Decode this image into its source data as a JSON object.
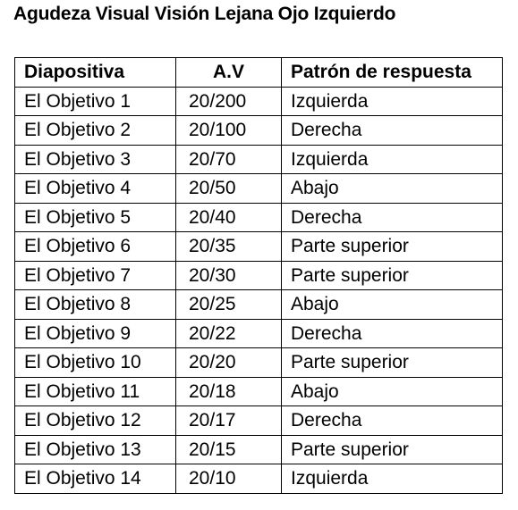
{
  "document": {
    "title": "Agudeza Visual Visión Lejana Ojo Izquierdo"
  },
  "table": {
    "headers": [
      "Diapositiva",
      "A.V",
      "Patrón de respuesta"
    ],
    "rows": [
      [
        "El Objetivo 1",
        "20/200",
        "Izquierda"
      ],
      [
        "El Objetivo 2",
        "20/100",
        "Derecha"
      ],
      [
        "El Objetivo 3",
        "20/70",
        "Izquierda"
      ],
      [
        "El Objetivo 4",
        "20/50",
        "Abajo"
      ],
      [
        "El Objetivo 5",
        "20/40",
        "Derecha"
      ],
      [
        "El Objetivo 6",
        "20/35",
        "Parte superior"
      ],
      [
        "El Objetivo 7",
        "20/30",
        "Parte superior"
      ],
      [
        "El Objetivo 8",
        "20/25",
        "Abajo"
      ],
      [
        "El Objetivo 9",
        "20/22",
        "Derecha"
      ],
      [
        "El Objetivo 10",
        "20/20",
        "Parte superior"
      ],
      [
        "El Objetivo 11",
        "20/18",
        "Abajo"
      ],
      [
        "El Objetivo 12",
        "20/17",
        "Derecha"
      ],
      [
        "El Objetivo 13",
        "20/15",
        "Parte superior"
      ],
      [
        "El Objetivo 14",
        "20/10",
        "Izquierda"
      ]
    ]
  }
}
